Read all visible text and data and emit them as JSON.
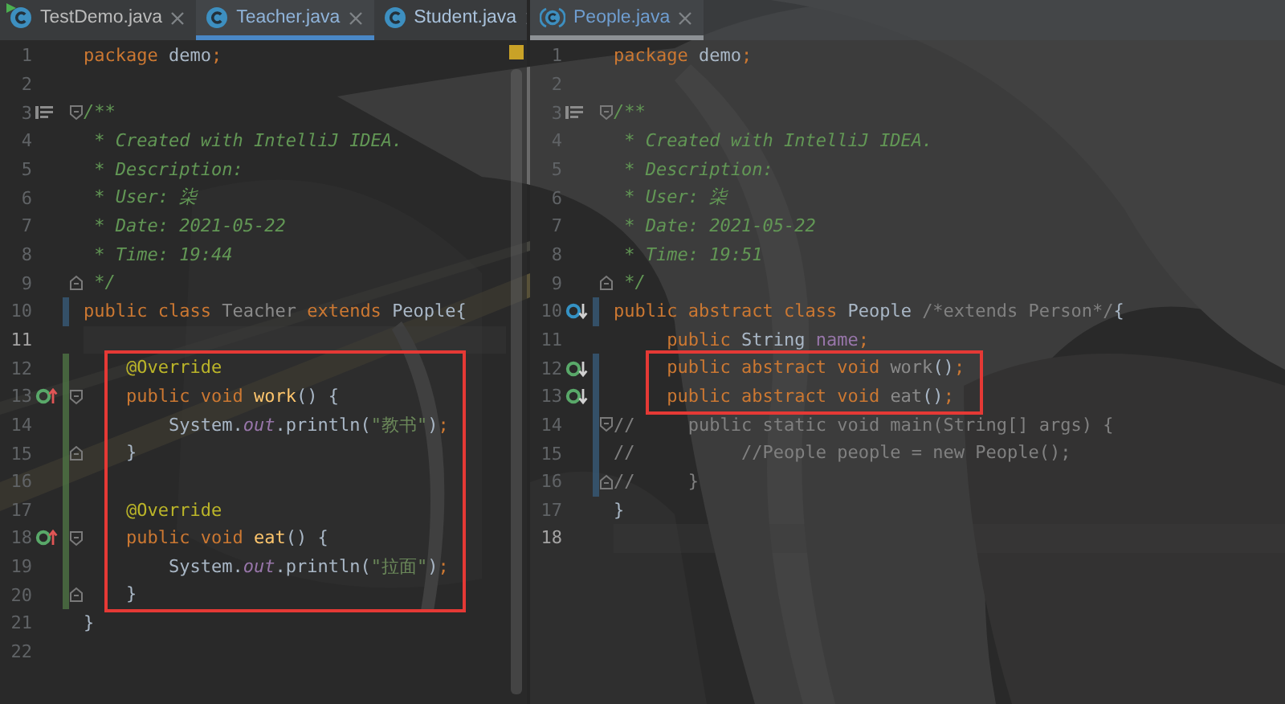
{
  "panes": [
    {
      "focused": true,
      "scrollbar": true,
      "warning": true,
      "tabs": [
        {
          "label": "TestDemo.java",
          "selected": false,
          "kind": "class",
          "runnable": true,
          "color": "#bbbbbb"
        },
        {
          "label": "Teacher.java",
          "selected": true,
          "kind": "class",
          "runnable": false,
          "color": "#8fb3d9"
        },
        {
          "label": "Student.java",
          "selected": false,
          "kind": "class",
          "runnable": false,
          "color": "#a9c2dc"
        }
      ],
      "lines": [
        {
          "number": "1",
          "code": [
            {
              "kind": "keyword",
              "text": "package"
            },
            {
              "kind": "plain",
              "text": " demo"
            },
            {
              "kind": "keyword",
              "text": ";"
            }
          ]
        },
        {
          "number": "2"
        },
        {
          "number": "3",
          "gutter": {
            "kind": "doc"
          },
          "fold_start": true,
          "code": [
            {
              "kind": "doc",
              "text": "/**"
            }
          ]
        },
        {
          "number": "4",
          "code": [
            {
              "kind": "doc",
              "text": " * Created with IntelliJ IDEA."
            }
          ]
        },
        {
          "number": "5",
          "code": [
            {
              "kind": "doc",
              "text": " * Description:"
            }
          ]
        },
        {
          "number": "6",
          "code": [
            {
              "kind": "doc",
              "text": " * User: 柒"
            }
          ]
        },
        {
          "number": "7",
          "code": [
            {
              "kind": "doc",
              "text": " * Date: 2021-05-22"
            }
          ]
        },
        {
          "number": "8",
          "code": [
            {
              "kind": "doc",
              "text": " * Time: 19:44"
            }
          ]
        },
        {
          "number": "9",
          "fold_end": true,
          "code": [
            {
              "kind": "doc",
              "text": " */"
            }
          ]
        },
        {
          "number": "10",
          "modified": true,
          "code": [
            {
              "kind": "keyword",
              "text": "public class "
            },
            {
              "kind": "unused",
              "text": "Teacher"
            },
            {
              "kind": "keyword",
              "text": " extends "
            },
            {
              "kind": "plain",
              "text": "People{"
            }
          ]
        },
        {
          "number": "11",
          "current": true
        },
        {
          "number": "12",
          "added": true,
          "boxed": true,
          "code": [
            {
              "kind": "annotation",
              "text": "    @Override"
            }
          ]
        },
        {
          "number": "13",
          "added": true,
          "boxed": true,
          "gutter": {
            "kind": "override"
          },
          "fold_start": true,
          "code": [
            {
              "kind": "keyword",
              "text": "    public void "
            },
            {
              "kind": "method",
              "text": "work"
            },
            {
              "kind": "plain",
              "text": "() {"
            }
          ]
        },
        {
          "number": "14",
          "added": true,
          "boxed": true,
          "code": [
            {
              "kind": "plain",
              "text": "        System."
            },
            {
              "kind": "static-field",
              "text": "out"
            },
            {
              "kind": "plain",
              "text": ".println("
            },
            {
              "kind": "string",
              "text": "\"教书\""
            },
            {
              "kind": "plain",
              "text": ")"
            },
            {
              "kind": "keyword",
              "text": ";"
            }
          ]
        },
        {
          "number": "15",
          "added": true,
          "boxed": true,
          "fold_end": true,
          "code": [
            {
              "kind": "plain",
              "text": "    }"
            }
          ]
        },
        {
          "number": "16",
          "added": true,
          "boxed": true
        },
        {
          "number": "17",
          "added": true,
          "boxed": true,
          "code": [
            {
              "kind": "annotation",
              "text": "    @Override"
            }
          ]
        },
        {
          "number": "18",
          "added": true,
          "boxed": true,
          "gutter": {
            "kind": "override"
          },
          "fold_start": true,
          "code": [
            {
              "kind": "keyword",
              "text": "    public void "
            },
            {
              "kind": "method",
              "text": "eat"
            },
            {
              "kind": "plain",
              "text": "() {"
            }
          ]
        },
        {
          "number": "19",
          "added": true,
          "boxed": true,
          "code": [
            {
              "kind": "plain",
              "text": "        System."
            },
            {
              "kind": "static-field",
              "text": "out"
            },
            {
              "kind": "plain",
              "text": ".println("
            },
            {
              "kind": "string",
              "text": "\"拉面\""
            },
            {
              "kind": "plain",
              "text": ")"
            },
            {
              "kind": "keyword",
              "text": ";"
            }
          ]
        },
        {
          "number": "20",
          "added": true,
          "boxed": true,
          "fold_end": true,
          "code": [
            {
              "kind": "plain",
              "text": "    }"
            }
          ]
        },
        {
          "number": "21",
          "code": [
            {
              "kind": "plain",
              "text": "}"
            }
          ]
        },
        {
          "number": "22"
        }
      ]
    },
    {
      "focused": false,
      "tabs": [
        {
          "label": "People.java",
          "selected": true,
          "kind": "abstract-class",
          "runnable": false,
          "color": "#6f9ed1"
        }
      ],
      "lines": [
        {
          "number": "1",
          "code": [
            {
              "kind": "keyword",
              "text": "package"
            },
            {
              "kind": "plain",
              "text": " demo"
            },
            {
              "kind": "keyword",
              "text": ";"
            }
          ]
        },
        {
          "number": "2"
        },
        {
          "number": "3",
          "gutter": {
            "kind": "doc"
          },
          "fold_start": true,
          "code": [
            {
              "kind": "doc",
              "text": "/**"
            }
          ]
        },
        {
          "number": "4",
          "code": [
            {
              "kind": "doc",
              "text": " * Created with IntelliJ IDEA."
            }
          ]
        },
        {
          "number": "5",
          "code": [
            {
              "kind": "doc",
              "text": " * Description:"
            }
          ]
        },
        {
          "number": "6",
          "code": [
            {
              "kind": "doc",
              "text": " * User: 柒"
            }
          ]
        },
        {
          "number": "7",
          "code": [
            {
              "kind": "doc",
              "text": " * Date: 2021-05-22"
            }
          ]
        },
        {
          "number": "8",
          "code": [
            {
              "kind": "doc",
              "text": " * Time: 19:51"
            }
          ]
        },
        {
          "number": "9",
          "fold_end": true,
          "code": [
            {
              "kind": "doc",
              "text": " */"
            }
          ]
        },
        {
          "number": "10",
          "modified": true,
          "gutter": {
            "kind": "subclassed"
          },
          "code": [
            {
              "kind": "keyword",
              "text": "public abstract class "
            },
            {
              "kind": "plain",
              "text": "People "
            },
            {
              "kind": "comment",
              "text": "/*extends Person*/"
            },
            {
              "kind": "plain",
              "text": "{"
            }
          ]
        },
        {
          "number": "11",
          "code": [
            {
              "kind": "keyword",
              "text": "     public "
            },
            {
              "kind": "plain",
              "text": "String "
            },
            {
              "kind": "field",
              "text": "name"
            },
            {
              "kind": "keyword",
              "text": ";"
            }
          ]
        },
        {
          "number": "12",
          "modified": true,
          "boxed": true,
          "gutter": {
            "kind": "implemented"
          },
          "code": [
            {
              "kind": "keyword",
              "text": "     public abstract void "
            },
            {
              "kind": "unused",
              "text": "work"
            },
            {
              "kind": "plain",
              "text": "()"
            },
            {
              "kind": "keyword",
              "text": ";"
            }
          ]
        },
        {
          "number": "13",
          "modified": true,
          "boxed": true,
          "gutter": {
            "kind": "implemented"
          },
          "code": [
            {
              "kind": "keyword",
              "text": "     public abstract void "
            },
            {
              "kind": "unused",
              "text": "eat"
            },
            {
              "kind": "plain",
              "text": "()"
            },
            {
              "kind": "keyword",
              "text": ";"
            }
          ]
        },
        {
          "number": "14",
          "modified": true,
          "fold_start": true,
          "code": [
            {
              "kind": "comment",
              "text": "//     public static void main(String[] args) {"
            }
          ]
        },
        {
          "number": "15",
          "modified": true,
          "code": [
            {
              "kind": "comment",
              "text": "//          //People people = new People();"
            }
          ]
        },
        {
          "number": "16",
          "modified": true,
          "fold_end": true,
          "code": [
            {
              "kind": "comment",
              "text": "//     }"
            }
          ]
        },
        {
          "number": "17",
          "code": [
            {
              "kind": "plain",
              "text": "}"
            }
          ]
        },
        {
          "number": "18",
          "current": true
        }
      ]
    }
  ]
}
